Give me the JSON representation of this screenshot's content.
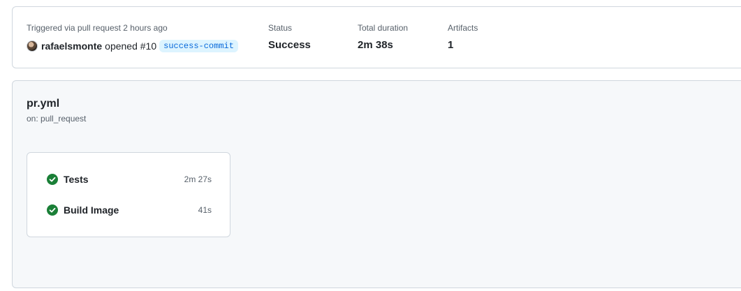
{
  "summary": {
    "trigger_text": "Triggered via pull request 2 hours ago",
    "actor": "rafaelsmonte",
    "opened_text": "opened #10",
    "branch": "success-commit",
    "status_label": "Status",
    "status_value": "Success",
    "duration_label": "Total duration",
    "duration_value": "2m 38s",
    "artifacts_label": "Artifacts",
    "artifacts_value": "1"
  },
  "workflow": {
    "name": "pr.yml",
    "trigger": "on: pull_request",
    "jobs": [
      {
        "name": "Tests",
        "duration": "2m 27s",
        "status": "success",
        "icon": "check-circle-icon"
      },
      {
        "name": "Build Image",
        "duration": "41s",
        "status": "success",
        "icon": "check-circle-icon"
      }
    ]
  },
  "colors": {
    "success": "#1a7f37",
    "link_badge_bg": "#ddf4ff",
    "link_badge_text": "#0969da",
    "panel_bg": "#f6f8fa",
    "border": "#d0d7de",
    "muted_text": "#57606a"
  }
}
